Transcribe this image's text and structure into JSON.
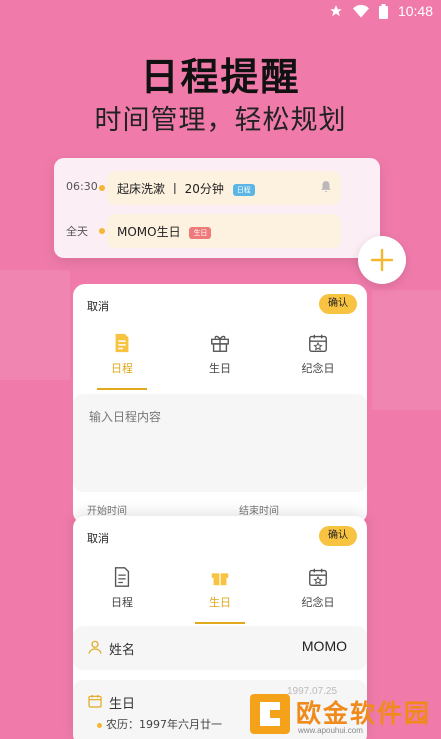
{
  "status_bar": {
    "time": "10:48"
  },
  "hero": {
    "title": "日程提醒",
    "subtitle": "时间管理，轻松规划"
  },
  "reminders": [
    {
      "time": "06:30",
      "text": "起床洗漱 丨 20分钟",
      "tag": "日程",
      "tag_color": "#5bb6e6",
      "has_bell": true
    },
    {
      "time": "全天",
      "text": "MOMO生日",
      "tag": "生日",
      "tag_color": "#ef7a7a",
      "has_bell": false
    }
  ],
  "schedule_form": {
    "cancel_label": "取消",
    "confirm_label": "确认",
    "tabs": [
      {
        "label": "日程",
        "icon": "document-icon",
        "active": true
      },
      {
        "label": "生日",
        "icon": "gift-icon",
        "active": false
      },
      {
        "label": "纪念日",
        "icon": "calendar-star-icon",
        "active": false
      }
    ],
    "content_placeholder": "输入日程内容",
    "start_time_label": "开始时间",
    "end_time_label": "结束时间"
  },
  "birthday_form": {
    "cancel_label": "取消",
    "confirm_label": "确认",
    "tabs": [
      {
        "label": "日程",
        "icon": "document-icon",
        "active": false
      },
      {
        "label": "生日",
        "icon": "gift-icon",
        "active": true
      },
      {
        "label": "纪念日",
        "icon": "calendar-star-icon",
        "active": false
      }
    ],
    "name_label": "姓名",
    "name_value": "MOMO",
    "birthday_label": "生日",
    "birthday_faded_value": "1997.07.25",
    "lunar_value": "农历：1997年六月廿一"
  },
  "watermark": {
    "text": "欧金软件园",
    "sub": "www.apouhui.com"
  },
  "colors": {
    "background": "#f07bab",
    "accent": "#f8c341",
    "active_tab": "#e0a91c"
  }
}
